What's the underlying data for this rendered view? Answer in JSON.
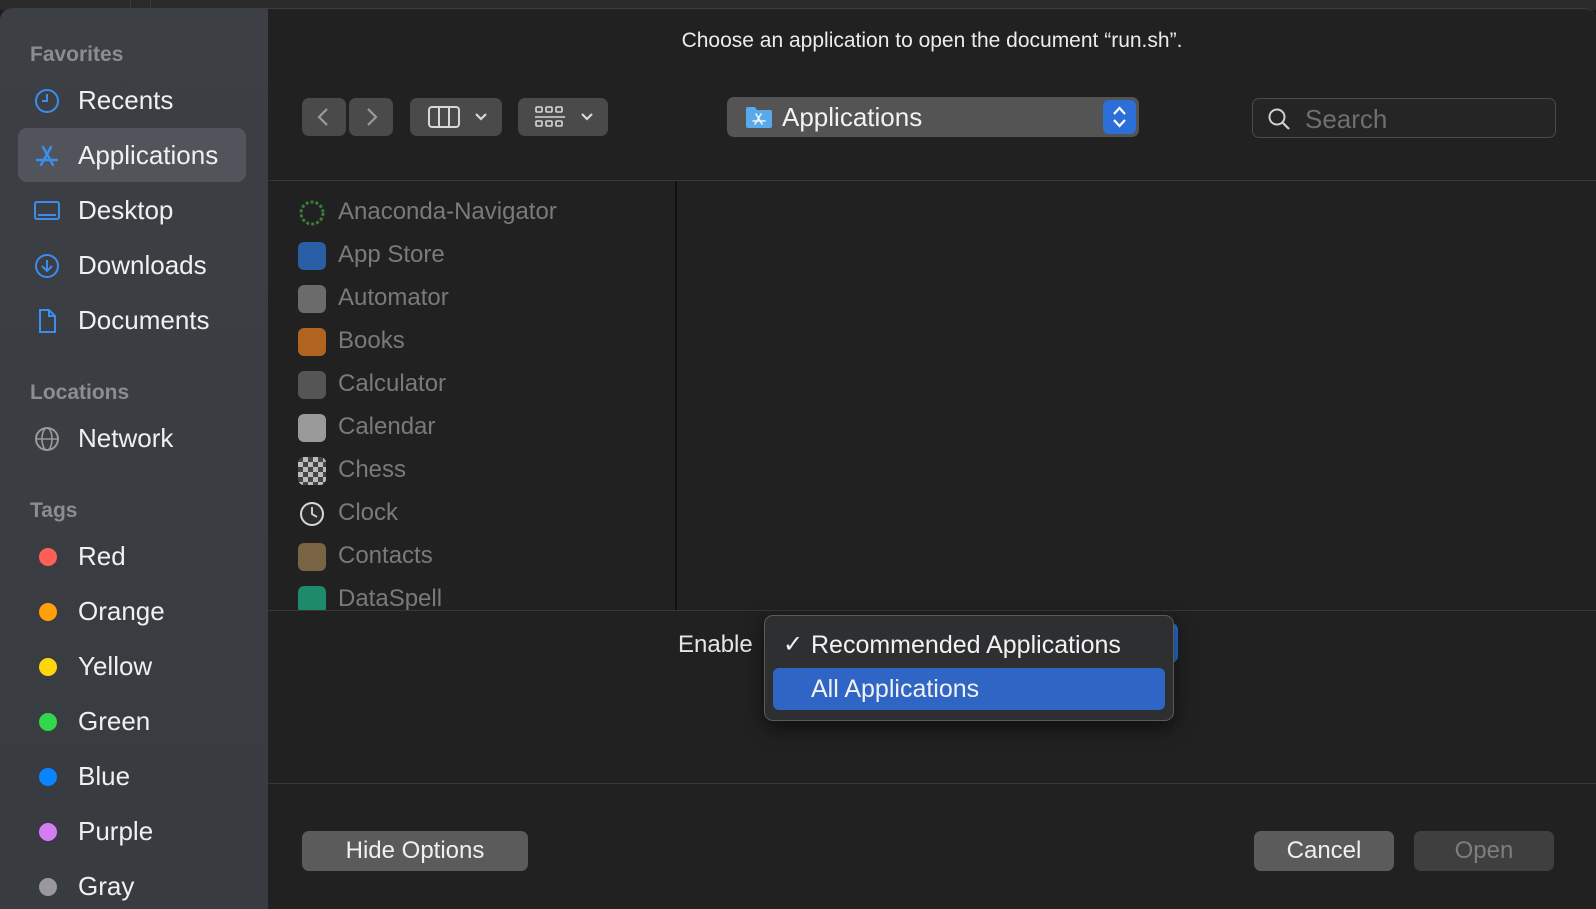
{
  "dialog": {
    "title": "Choose an application to open the document “run.sh”."
  },
  "sidebar": {
    "favorites_title": "Favorites",
    "favorites": [
      {
        "label": "Recents",
        "icon": "clock-icon"
      },
      {
        "label": "Applications",
        "icon": "applications-icon",
        "selected": true
      },
      {
        "label": "Desktop",
        "icon": "desktop-icon"
      },
      {
        "label": "Downloads",
        "icon": "download-icon"
      },
      {
        "label": "Documents",
        "icon": "document-icon"
      }
    ],
    "locations_title": "Locations",
    "locations": [
      {
        "label": "Network",
        "icon": "globe-icon"
      }
    ],
    "tags_title": "Tags",
    "tags": [
      {
        "label": "Red",
        "color": "#ff5f57"
      },
      {
        "label": "Orange",
        "color": "#ff9f0a"
      },
      {
        "label": "Yellow",
        "color": "#ffd60a"
      },
      {
        "label": "Green",
        "color": "#32d74b"
      },
      {
        "label": "Blue",
        "color": "#0a84ff"
      },
      {
        "label": "Purple",
        "color": "#d77cf0"
      },
      {
        "label": "Gray",
        "color": "#98989d"
      }
    ]
  },
  "toolbar": {
    "back_icon": "chevron-left-icon",
    "forward_icon": "chevron-right-icon",
    "view_icon": "columns-view-icon",
    "group_icon": "grid-view-icon",
    "location": "Applications",
    "search_placeholder": "Search"
  },
  "files": [
    {
      "label": "Anaconda-Navigator",
      "icon": "anaconda-icon",
      "color": "#3a7d3a"
    },
    {
      "label": "App Store",
      "icon": "app-store-icon",
      "color": "#2a5fa8"
    },
    {
      "label": "Automator",
      "icon": "automator-icon",
      "color": "#6b6b6b"
    },
    {
      "label": "Books",
      "icon": "books-icon",
      "color": "#b0641f"
    },
    {
      "label": "Calculator",
      "icon": "calculator-icon",
      "color": "#555555"
    },
    {
      "label": "Calendar",
      "icon": "calendar-icon",
      "color": "#9a9a9a"
    },
    {
      "label": "Chess",
      "icon": "chess-icon",
      "color": "#4e4e4e"
    },
    {
      "label": "Clock",
      "icon": "clock-app-icon",
      "color": "#8c8c8c"
    },
    {
      "label": "Contacts",
      "icon": "contacts-icon",
      "color": "#7a6446"
    },
    {
      "label": "DataSpell",
      "icon": "dataspell-icon",
      "color": "#1f8a6a"
    }
  ],
  "options": {
    "enable_label": "Enable",
    "menu": [
      {
        "label": "Recommended Applications",
        "checked": "✓",
        "highlighted": false
      },
      {
        "label": "All Applications",
        "checked": "",
        "highlighted": true
      }
    ]
  },
  "buttons": {
    "hide_options": "Hide Options",
    "cancel": "Cancel",
    "open": "Open"
  },
  "colors": {
    "accent": "#2c6fd9",
    "menu_highlight": "#2f65c5"
  }
}
